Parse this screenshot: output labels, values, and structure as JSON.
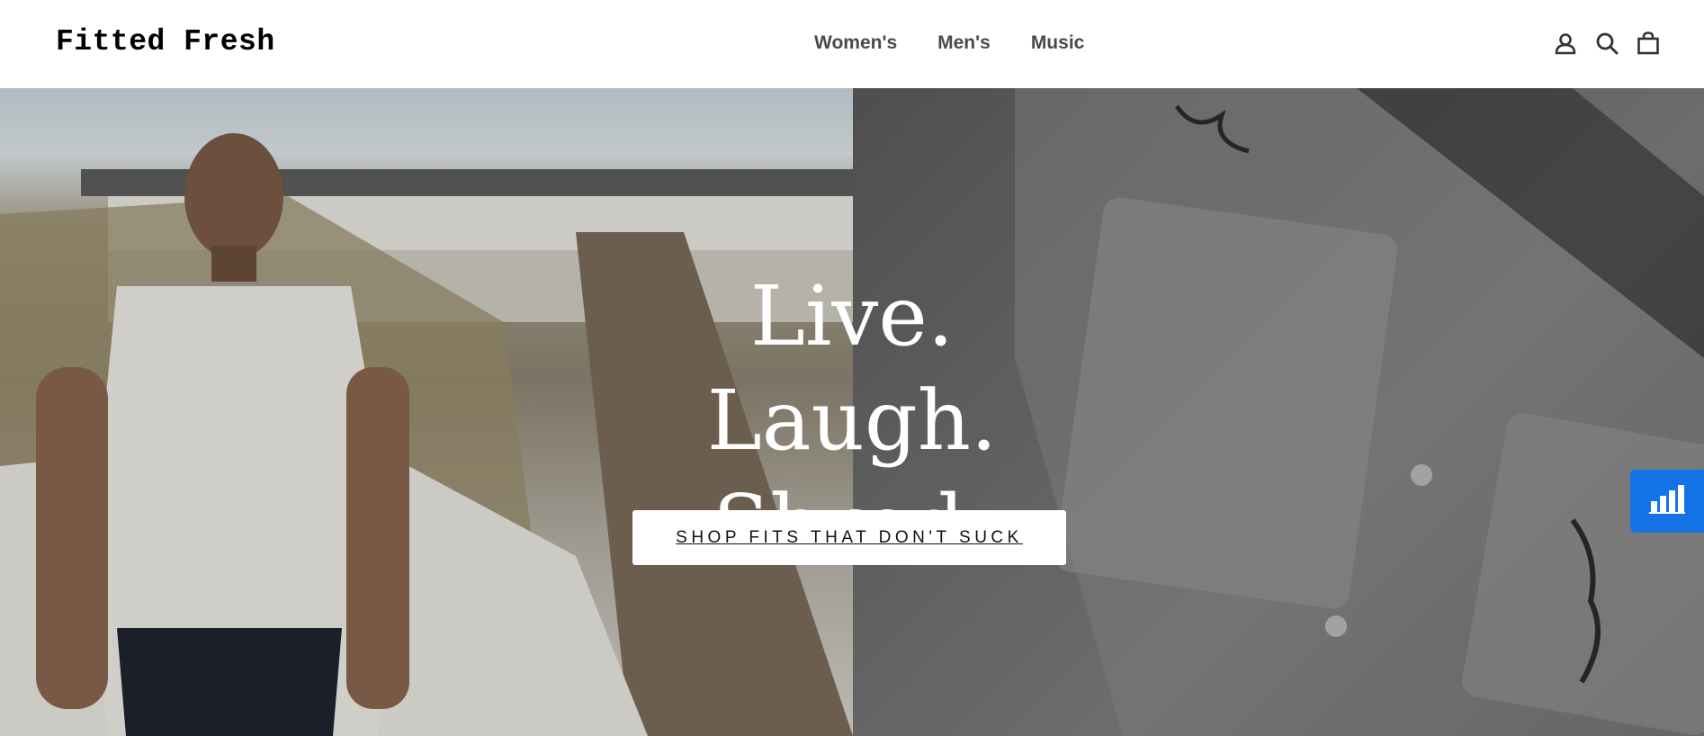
{
  "header": {
    "logo": "Fitted Fresh",
    "nav": [
      {
        "label": "Women's"
      },
      {
        "label": "Men's"
      },
      {
        "label": "Music"
      }
    ],
    "icons": [
      "account-icon",
      "search-icon",
      "cart-icon"
    ]
  },
  "hero": {
    "headline_lines": [
      "Live.",
      "Laugh.",
      "Shred."
    ],
    "cta_label": "SHOP FITS THAT DON'T SUCK"
  },
  "floating_widget": {
    "icon": "bar-chart-icon",
    "color": "#1473e6"
  }
}
